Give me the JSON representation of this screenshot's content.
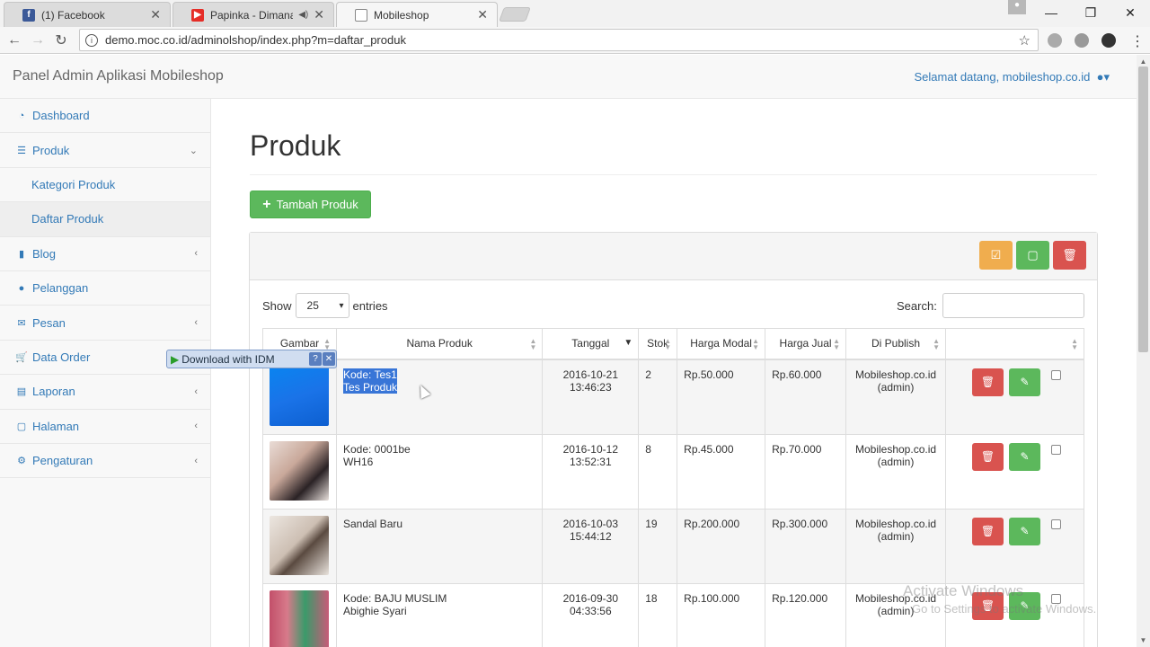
{
  "browser": {
    "tabs": [
      {
        "title": "(1) Facebook",
        "icon": "facebook-icon"
      },
      {
        "title": "Papinka - Dimana Hat",
        "icon": "youtube-icon"
      },
      {
        "title": "Mobileshop",
        "icon": "page-icon"
      }
    ],
    "url": "demo.moc.co.id/adminolshop/index.php?m=daftar_produk"
  },
  "app": {
    "brand": "Panel Admin Aplikasi Mobileshop",
    "welcome": "Selamat datang, mobileshop.co.id"
  },
  "sidebar": {
    "items": [
      {
        "label": "Dashboard",
        "icon": "dashboard-icon"
      },
      {
        "label": "Produk",
        "icon": "list-icon",
        "expanded": true
      },
      {
        "label": "Kategori Produk"
      },
      {
        "label": "Daftar Produk",
        "selected": true
      },
      {
        "label": "Blog",
        "icon": "book-icon"
      },
      {
        "label": "Pelanggan",
        "icon": "user-icon"
      },
      {
        "label": "Pesan",
        "icon": "envelope-icon"
      },
      {
        "label": "Data Order",
        "icon": "cart-icon"
      },
      {
        "label": "Laporan",
        "icon": "file-icon"
      },
      {
        "label": "Halaman",
        "icon": "page-icon"
      },
      {
        "label": "Pengaturan",
        "icon": "gear-icon"
      }
    ]
  },
  "page": {
    "title": "Produk",
    "add_button": "Tambah Produk",
    "show_label": "Show",
    "entries_value": "25",
    "entries_label": "entries",
    "search_label": "Search:"
  },
  "table": {
    "headers": [
      "Gambar",
      "Nama Produk",
      "Tanggal",
      "Stok",
      "Harga Modal",
      "Harga Jual",
      "Di Publish",
      ""
    ],
    "rows": [
      {
        "kode": "Kode: Tes1",
        "nama": "Tes Produk",
        "tanggal": "2016-10-21",
        "jam": "13:46:23",
        "stok": "2",
        "modal": "Rp.50.000",
        "jual": "Rp.60.000",
        "publish": "Mobileshop.co.id",
        "by": "(admin)"
      },
      {
        "kode": "Kode: 0001be",
        "nama": "WH16",
        "tanggal": "2016-10-12",
        "jam": "13:52:31",
        "stok": "8",
        "modal": "Rp.45.000",
        "jual": "Rp.70.000",
        "publish": "Mobileshop.co.id",
        "by": "(admin)"
      },
      {
        "kode": "Sandal Baru",
        "nama": "",
        "tanggal": "2016-10-03",
        "jam": "15:44:12",
        "stok": "19",
        "modal": "Rp.200.000",
        "jual": "Rp.300.000",
        "publish": "Mobileshop.co.id",
        "by": "(admin)"
      },
      {
        "kode": "Kode: BAJU MUSLIM",
        "nama": "Abighie Syari",
        "tanggal": "2016-09-30",
        "jam": "04:33:56",
        "stok": "18",
        "modal": "Rp.100.000",
        "jual": "Rp.120.000",
        "publish": "Mobileshop.co.id",
        "by": "(admin)"
      }
    ]
  },
  "idm": {
    "label": "Download with IDM"
  },
  "watermark": {
    "line1": "Activate Windows",
    "line2": "Go to Settings to activate Windows."
  },
  "colors": {
    "primary": "#337ab7",
    "success": "#5cb85c",
    "warning": "#f0ad4e",
    "danger": "#d9534f"
  }
}
